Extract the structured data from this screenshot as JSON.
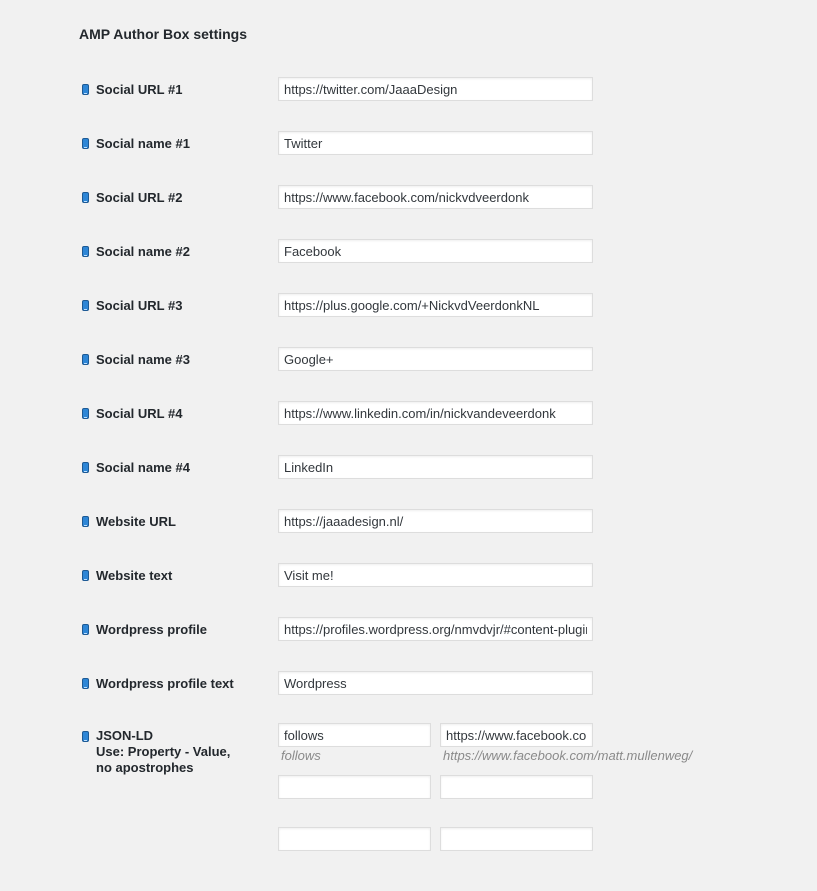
{
  "page_title": "AMP Author Box settings",
  "icon": "phone-icon",
  "fields": [
    {
      "label": "Social URL #1",
      "value": "https://twitter.com/JaaaDesign"
    },
    {
      "label": "Social name #1",
      "value": "Twitter"
    },
    {
      "label": "Social URL #2",
      "value": "https://www.facebook.com/nickvdveerdonk"
    },
    {
      "label": "Social name #2",
      "value": "Facebook"
    },
    {
      "label": "Social URL #3",
      "value": "https://plus.google.com/+NickvdVeerdonkNL"
    },
    {
      "label": "Social name #3",
      "value": "Google+"
    },
    {
      "label": "Social URL #4",
      "value": "https://www.linkedin.com/in/nickvandeveerdonk"
    },
    {
      "label": "Social name #4",
      "value": "LinkedIn"
    },
    {
      "label": "Website URL",
      "value": "https://jaaadesign.nl/"
    },
    {
      "label": "Website text",
      "value": "Visit me!"
    },
    {
      "label": "Wordpress profile",
      "value": "https://profiles.wordpress.org/nmvdvjr/#content-plugins"
    },
    {
      "label": "Wordpress profile text",
      "value": "Wordpress"
    }
  ],
  "json_ld": {
    "label_line1": "JSON-LD",
    "label_line2": "Use: Property - Value,",
    "label_line3": "no apostrophes",
    "rows": [
      {
        "property": "follows",
        "value": "https://www.facebook.com/matt.mullenweg/",
        "property_hint": "follows",
        "value_hint": "https://www.facebook.com/matt.mullenweg/"
      },
      {
        "property": "",
        "value": ""
      },
      {
        "property": "",
        "value": ""
      }
    ]
  }
}
